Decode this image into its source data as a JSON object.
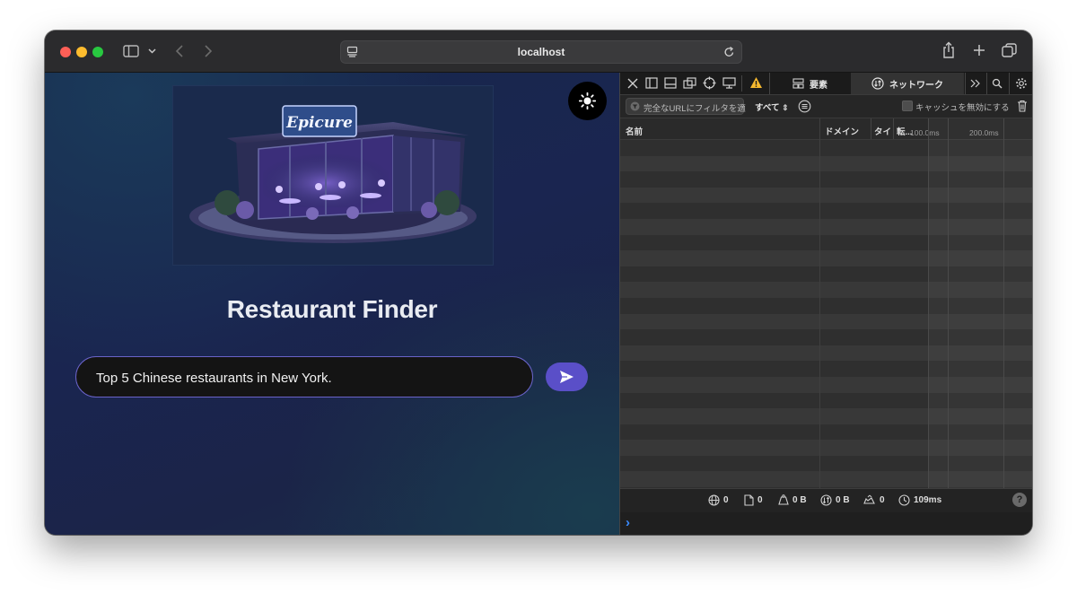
{
  "browser": {
    "url": "localhost",
    "icons": [
      "sidebar-icon",
      "chevron-down-icon",
      "back-icon",
      "forward-icon",
      "site-icon",
      "reload-icon",
      "share-icon",
      "new-tab-icon",
      "tab-overview-icon"
    ]
  },
  "app": {
    "title": "Restaurant Finder",
    "hero_sign": "Epicure",
    "search": {
      "value": "Top 5 Chinese restaurants in New York."
    },
    "colors": {
      "accent": "#5a4fc8",
      "search_border": "#6a63c9"
    }
  },
  "devtools": {
    "tabs": {
      "elements": "要素",
      "network": "ネットワーク"
    },
    "filter": {
      "placeholder": "完全なURLにフィルタを適",
      "type": "すべて",
      "disable_cache": "キャッシュを無効にする"
    },
    "columns": {
      "name": "名前",
      "domain": "ドメイン",
      "type": "タイ",
      "transfer": "転...",
      "t1": "100.0ms",
      "t2": "200.0ms"
    },
    "status": {
      "requests": "0",
      "resources": "0",
      "transferred": "0 B",
      "size": "0 B",
      "redirects": "0",
      "time": "109ms"
    },
    "help": "?",
    "prompt": "›"
  }
}
